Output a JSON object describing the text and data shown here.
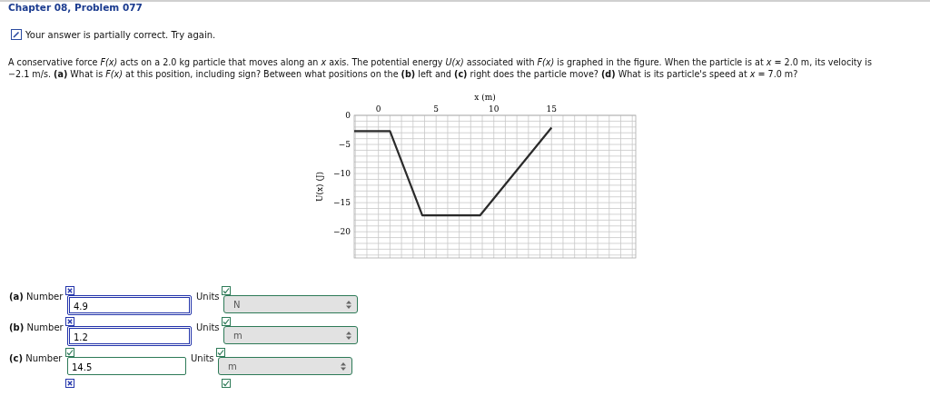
{
  "header": {
    "title": "Chapter 08, Problem 077"
  },
  "feedback": {
    "text": "Your answer is partially correct.  Try again."
  },
  "problem": {
    "text": "A conservative force *F(x)* acts on a 2.0 kg particle that moves along an *x* axis. The potential energy *U(x)* associated with *F(x)* is graphed in the figure. When the particle is at *x* = 2.0 m, its velocity is −2.1 m/s. **(a)** What is *F(x)* at this position, including sign? Between what positions on the **(b)** left and **(c)** right does the particle move? **(d)** What is its particle's speed at *x* = 7.0 m?"
  },
  "figure": {
    "chart_data": {
      "type": "line",
      "grid": true,
      "xlabel": "x (m)",
      "ylabel": "U(x) (J)",
      "xlim": [
        -2.1,
        22.3
      ],
      "ylim": [
        -24.5,
        0
      ],
      "xticks": [
        {
          "value": 0,
          "label": "0"
        },
        {
          "value": 5,
          "label": "5"
        },
        {
          "value": 10,
          "label": "10"
        },
        {
          "value": 15,
          "label": "15"
        }
      ],
      "yticks": [
        {
          "value": 0,
          "label": "0"
        },
        {
          "value": -5,
          "label": "−5"
        },
        {
          "value": -10,
          "label": "−10"
        },
        {
          "value": -15,
          "label": "−15"
        },
        {
          "value": -20,
          "label": "−20"
        }
      ],
      "x": [
        -2.1,
        1.0,
        3.8,
        8.8,
        15.0
      ],
      "series": [
        {
          "color": "#2a2a2a",
          "values": [
            -2.7,
            -2.7,
            -17.2,
            -17.2,
            -2.1
          ]
        }
      ]
    }
  },
  "answers": [
    {
      "label": "**(a)** Number",
      "value": "4.9",
      "correct": false,
      "units_label": "Units",
      "units": "N",
      "units_correct": true
    },
    {
      "label": "**(b)** Number",
      "value": "1.2",
      "correct": false,
      "units_label": "Units",
      "units": "m",
      "units_correct": true
    },
    {
      "label": "**(c)** Number",
      "value": "14.5",
      "correct": true,
      "units_label": "Units",
      "units": "m",
      "units_correct": true
    },
    {
      "correct": false,
      "units_correct": true
    }
  ]
}
